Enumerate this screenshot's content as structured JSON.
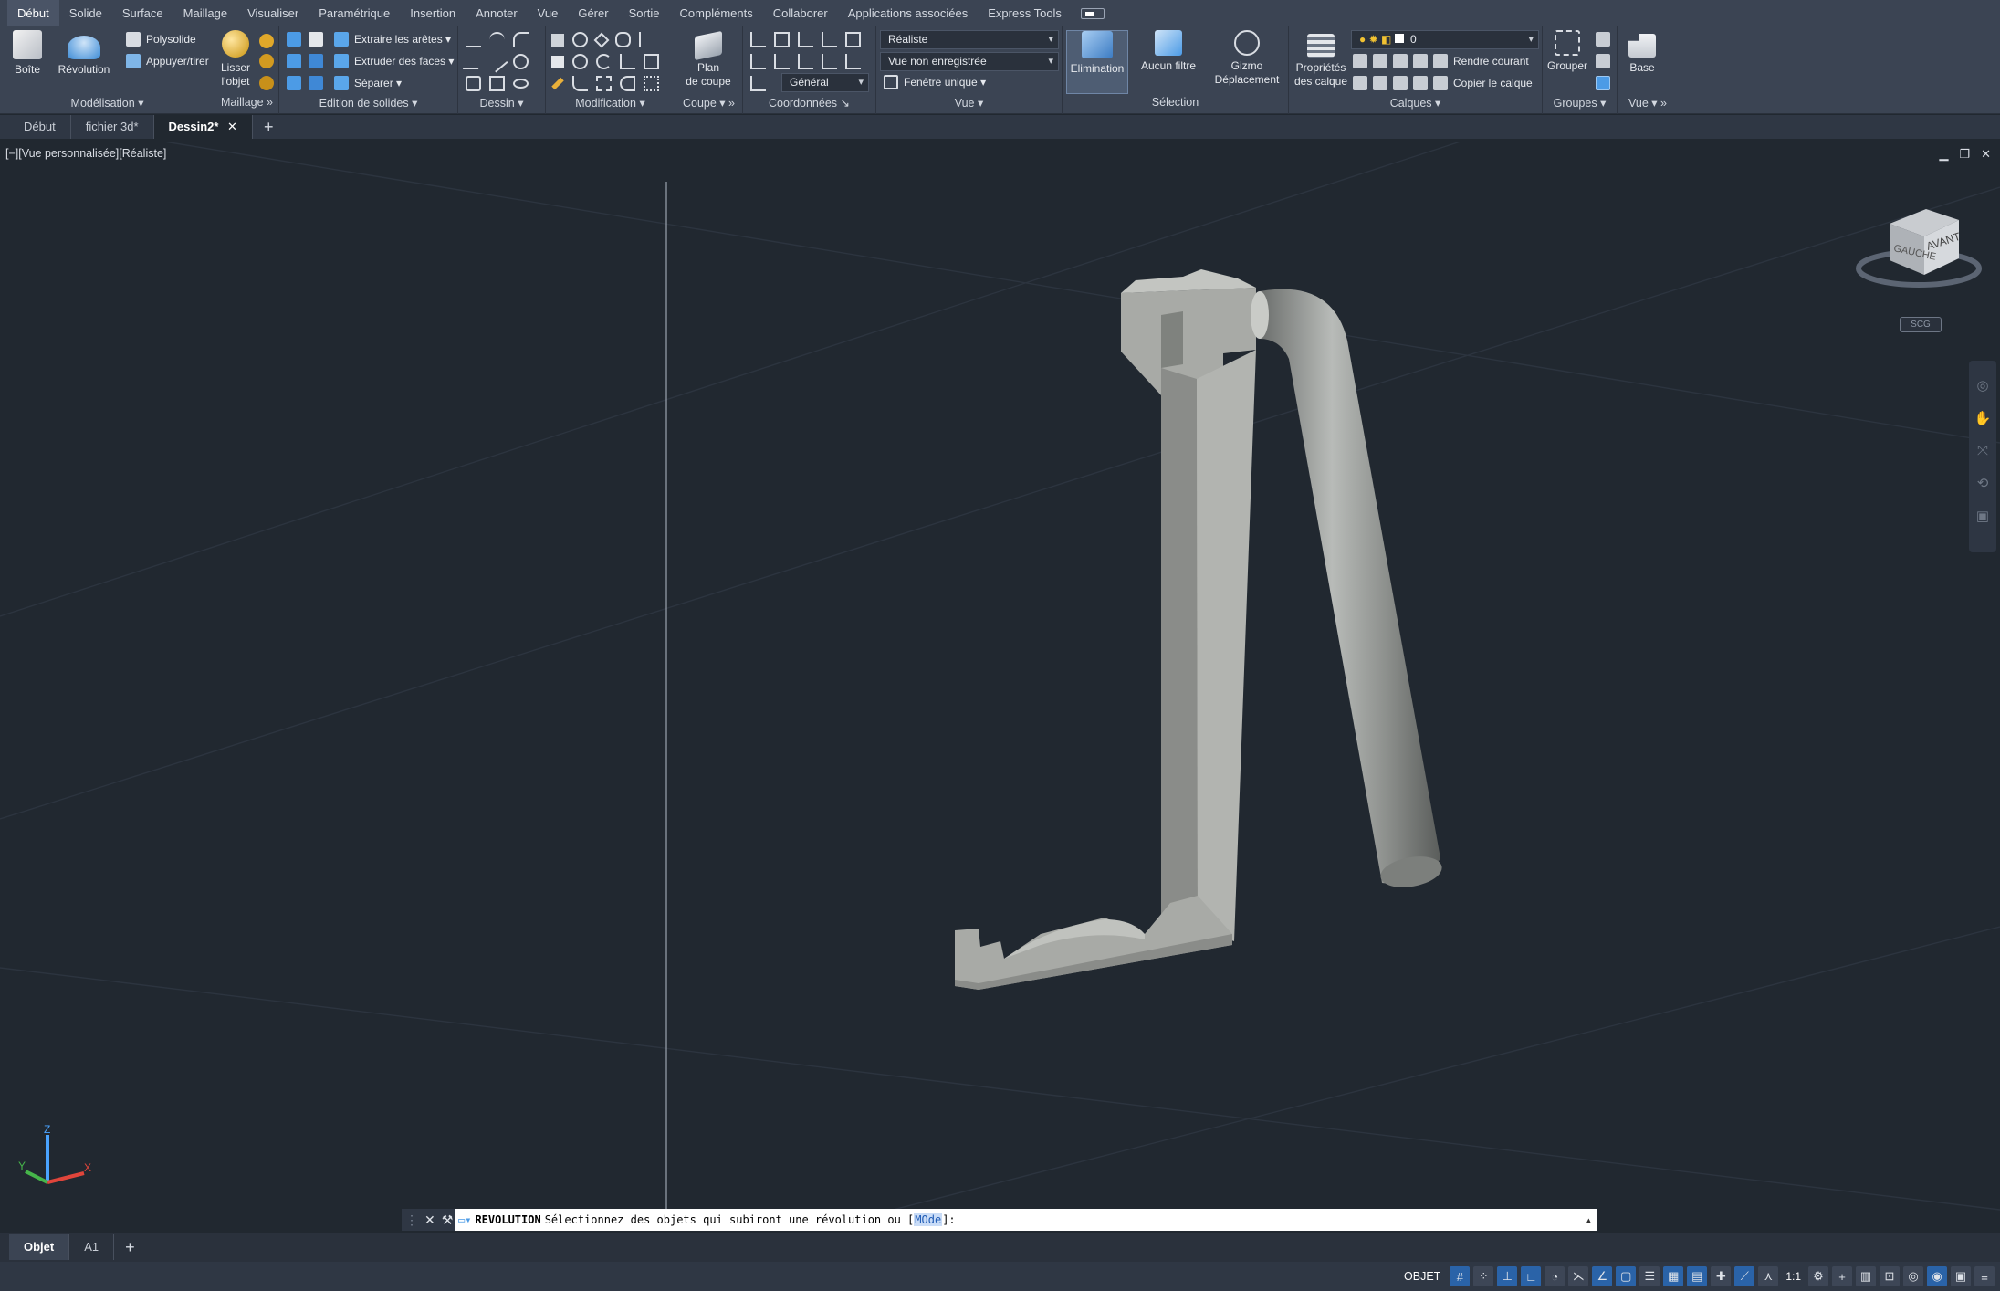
{
  "menu": {
    "tabs": [
      "Début",
      "Solide",
      "Surface",
      "Maillage",
      "Visualiser",
      "Paramétrique",
      "Insertion",
      "Annoter",
      "Vue",
      "Gérer",
      "Sortie",
      "Compléments",
      "Collaborer",
      "Applications associées",
      "Express Tools"
    ],
    "active": "Début"
  },
  "ribbon": {
    "modelisation": {
      "title": "Modélisation",
      "boite": "Boîte",
      "revolution": "Révolution",
      "polysolide": "Polysolide",
      "appuyer": "Appuyer/tirer"
    },
    "maillage": {
      "title": "Maillage",
      "lisser_l1": "Lisser",
      "lisser_l2": "l'objet"
    },
    "edition": {
      "title": "Edition de solides",
      "extraire": "Extraire les arêtes",
      "extruder": "Extruder des faces",
      "separer": "Séparer"
    },
    "dessin": {
      "title": "Dessin"
    },
    "modification": {
      "title": "Modification"
    },
    "coupe": {
      "title": "Coupe",
      "plan_l1": "Plan",
      "plan_l2": "de coupe"
    },
    "coordonnees": {
      "title": "Coordonnées",
      "general": "Général"
    },
    "vue": {
      "title": "Vue",
      "style": "Réaliste",
      "named_view": "Vue non enregistrée",
      "fenetre": "Fenêtre unique"
    },
    "selection": {
      "title": "Sélection",
      "elimination": "Elimination",
      "aucun_filtre": "Aucun filtre",
      "gizmo_l1": "Gizmo",
      "gizmo_l2": "Déplacement"
    },
    "calques": {
      "title": "Calques",
      "props_l1": "Propriétés",
      "props_l2": "des calque",
      "layer_value": "0",
      "rendre_courant": "Rendre courant",
      "copier": "Copier le calque"
    },
    "groupes": {
      "title": "Groupes",
      "grouper": "Grouper"
    },
    "vue2": {
      "title": "Vue",
      "base": "Base"
    }
  },
  "doctabs": [
    "Début",
    "fichier 3d*",
    "Dessin2*"
  ],
  "doctabs_active": "Dessin2*",
  "viewport": {
    "label": "[−][Vue personnalisée][Réaliste]",
    "cube_left": "GAUCHE",
    "cube_front": "AVANT",
    "scg": "SCG",
    "axis_x": "X",
    "axis_y": "Y",
    "axis_z": "Z"
  },
  "cmdline": {
    "command": "REVOLUTION",
    "prompt": "Sélectionnez des objets qui subiront une révolution ou [",
    "option": "MOde",
    "suffix": "]:"
  },
  "layouttabs": [
    "Objet",
    "A1"
  ],
  "layouttabs_active": "Objet",
  "status": {
    "mode": "OBJET",
    "scale": "1:1"
  },
  "colors": {
    "bg": "#212830",
    "ribbon": "#3b4453",
    "accent": "#2a63a8",
    "solid": "#a9aba7"
  }
}
